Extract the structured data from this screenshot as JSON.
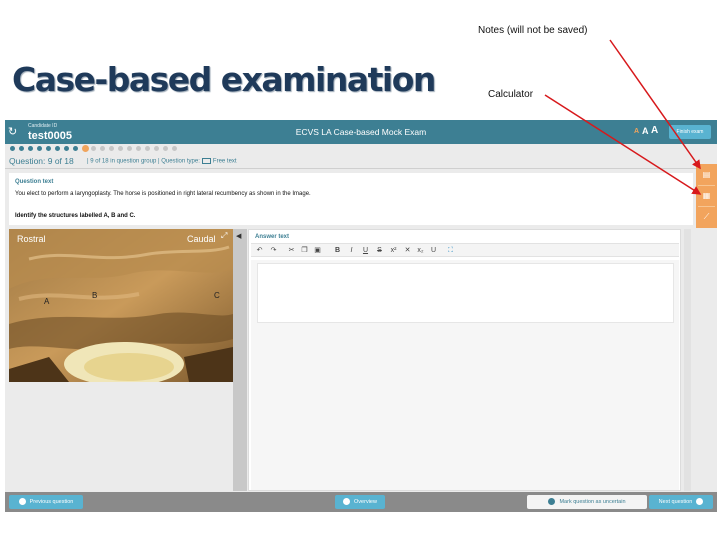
{
  "slide": {
    "title": "Case-based examination",
    "note_notes": "Notes (will not be saved)",
    "note_calculator": "Calculator",
    "arrow_color": "#d7191c"
  },
  "exam": {
    "topbar": {
      "candidate_label": "Candidate ID",
      "candidate_id": "test0005",
      "title": "ECVS LA Case-based Mock Exam",
      "font_size_small": "A",
      "font_size_medium": "A",
      "font_size_large": "A",
      "finish_label": "Finish exam"
    },
    "progress": {
      "total": 18,
      "current": 9
    },
    "question_info": {
      "main": "Question: 9 of 18",
      "group": "9 of 18 in question group",
      "type_label": "Question type:",
      "type_value": "Free text"
    },
    "question": {
      "label": "Question text",
      "text": "You elect to perform a laryngoplasty.  The horse is positioned in right lateral recumbency as shown in the Image.",
      "instruction": "Identify the structures labelled A, B and C."
    },
    "image": {
      "label_left": "Rostral",
      "label_right": "Caudal",
      "letter_a": "A",
      "letter_b": "B",
      "letter_c": "C"
    },
    "answer": {
      "label": "Answer text",
      "toolbar": [
        "undo-icon",
        "redo-icon",
        "cut-icon",
        "copy-icon",
        "paste-icon",
        "bold-icon",
        "italic-icon",
        "underline-icon",
        "strikethrough-icon",
        "superscript-icon",
        "subscript-icon",
        "remove-format-icon",
        "spellcheck-icon"
      ],
      "bold": "B",
      "italic": "I",
      "underline": "U",
      "strike": "S",
      "superscript": "x²",
      "subscript": "x₂",
      "clear": "U"
    },
    "sidebar": {
      "icons": [
        "notes-icon",
        "calculator-icon",
        "pen-icon"
      ]
    },
    "bottombar": {
      "previous": "Previous question",
      "overview": "Overview",
      "mark": "Mark question as uncertain",
      "next": "Next question"
    },
    "colors": {
      "header": "#3d7f93",
      "button": "#59b3d1",
      "accent": "#f2a45d"
    }
  }
}
